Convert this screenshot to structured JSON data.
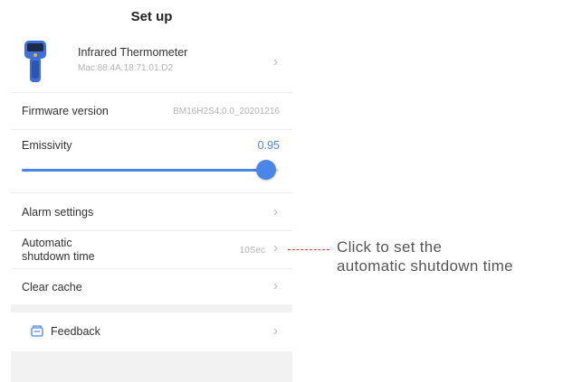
{
  "header": {
    "title": "Set up"
  },
  "device": {
    "name": "Infrared Thermometer",
    "mac": "Mac:88:4A:18:71:01:D2"
  },
  "settings": {
    "firmware_label": "Firmware version",
    "firmware_value": "BM16H2S4.0.0_20201216",
    "emissivity_label": "Emissivity",
    "emissivity_value": "0.95",
    "emissivity_level": 0.95,
    "alarm_label": "Alarm settings",
    "shutdown_label_line1": "Automatic",
    "shutdown_label_line2": "shutdown time",
    "shutdown_value": "10Sec",
    "cache_label": "Clear cache",
    "feedback_label": "Feedback"
  },
  "annotation": {
    "line1": "Click to set the",
    "line2": "automatic shutdown time",
    "color": "#e23b3b"
  },
  "colors": {
    "accent": "#4a86e8",
    "thermometer_body": "#3f6fd8"
  },
  "icons": {
    "chevron": "chevron-right-icon",
    "feedback": "feedback-icon",
    "device": "infrared-thermometer-icon"
  }
}
